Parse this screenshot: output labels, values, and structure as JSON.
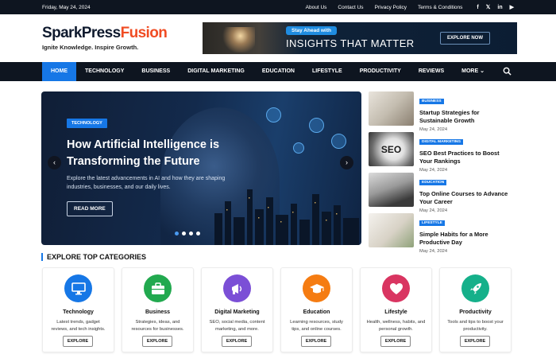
{
  "topbar": {
    "date": "Friday, May 24, 2024",
    "links": [
      "About Us",
      "Contact Us",
      "Privacy Policy",
      "Terms & Conditions"
    ],
    "social": [
      "f",
      "𝕏",
      "in",
      "▶"
    ]
  },
  "logo": {
    "part1": "SparkPress",
    "part2": "Fusion",
    "tagline": "Ignite Knowledge. Inspire Growth."
  },
  "ad": {
    "pill": "Stay Ahead with",
    "headline": "INSIGHTS THAT MATTER",
    "button": "EXPLORE NOW"
  },
  "nav": {
    "items": [
      "HOME",
      "TECHNOLOGY",
      "BUSINESS",
      "DIGITAL MARKETING",
      "EDUCATION",
      "LIFESTYLE",
      "PRODUCTIVITY",
      "REVIEWS",
      "MORE ⌄"
    ]
  },
  "hero": {
    "category": "TECHNOLOGY",
    "title": "How Artificial Intelligence is Transforming the Future",
    "excerpt": "Explore the latest advancements in AI and how they are shaping industries, businesses, and our daily lives.",
    "button": "READ MORE",
    "prev": "‹",
    "next": "›"
  },
  "side_posts": [
    {
      "category": "BUSINESS",
      "title": "Startup Strategies for Sustainable Growth",
      "date": "May 24, 2024"
    },
    {
      "category": "DIGITAL MARKETING",
      "title": "SEO Best Practices to Boost Your Rankings",
      "date": "May 24, 2024"
    },
    {
      "category": "EDUCATION",
      "title": "Top Online Courses to Advance Your Career",
      "date": "May 24, 2024"
    },
    {
      "category": "LIFESTYLE",
      "title": "Simple Habits for a More Productive Day",
      "date": "May 24, 2024"
    }
  ],
  "seo_thumb_text": "SEO",
  "categories": {
    "title": "EXPLORE TOP CATEGORIES",
    "button": "EXPLORE",
    "items": [
      {
        "name": "Technology",
        "desc": "Latest trends, gadget reviews, and tech insights.",
        "color": "#1677e6",
        "icon": "monitor-icon"
      },
      {
        "name": "Business",
        "desc": "Strategies, ideas, and resources for businesses.",
        "color": "#22a94f",
        "icon": "briefcase-icon"
      },
      {
        "name": "Digital Marketing",
        "desc": "SEO, social media, content marketing, and more.",
        "color": "#7b4fd6",
        "icon": "megaphone-icon"
      },
      {
        "name": "Education",
        "desc": "Learning resources, study tips, and online courses.",
        "color": "#f57c12",
        "icon": "graduation-cap-icon"
      },
      {
        "name": "Lifestyle",
        "desc": "Health, wellness, habits, and personal growth.",
        "color": "#d93561",
        "icon": "heart-icon"
      },
      {
        "name": "Productivity",
        "desc": "Tools and tips to boost your productivity.",
        "color": "#15b08a",
        "icon": "rocket-icon"
      }
    ]
  }
}
